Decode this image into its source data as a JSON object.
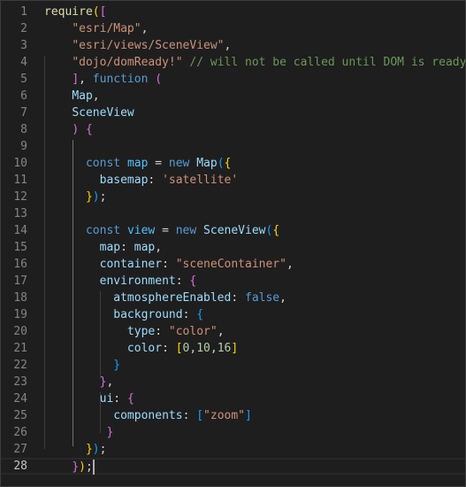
{
  "editor": {
    "language": "javascript",
    "current_line": 28,
    "lines": [
      {
        "n": "1",
        "tokens": [
          [
            "fn",
            "require"
          ],
          [
            "b1",
            "("
          ],
          [
            "b2",
            "["
          ]
        ]
      },
      {
        "n": "2",
        "tokens": [
          [
            "pun",
            "    "
          ],
          [
            "str",
            "\"esri/Map\""
          ],
          [
            "pun",
            ","
          ]
        ]
      },
      {
        "n": "3",
        "tokens": [
          [
            "pun",
            "    "
          ],
          [
            "str",
            "\"esri/views/SceneView\""
          ],
          [
            "pun",
            ","
          ]
        ]
      },
      {
        "n": "4",
        "tokens": [
          [
            "pun",
            "    "
          ],
          [
            "str",
            "\"dojo/domReady!\""
          ],
          [
            "pun",
            " "
          ],
          [
            "cmt",
            "// will not be called until DOM is ready"
          ]
        ]
      },
      {
        "n": "5",
        "tokens": [
          [
            "pun",
            "    "
          ],
          [
            "b2",
            "]"
          ],
          [
            "pun",
            ", "
          ],
          [
            "kw",
            "function"
          ],
          [
            "pun",
            " "
          ],
          [
            "b2",
            "("
          ]
        ]
      },
      {
        "n": "6",
        "tokens": [
          [
            "pun",
            "    "
          ],
          [
            "var",
            "Map"
          ],
          [
            "pun",
            ","
          ]
        ]
      },
      {
        "n": "7",
        "tokens": [
          [
            "pun",
            "    "
          ],
          [
            "var",
            "SceneView"
          ]
        ]
      },
      {
        "n": "8",
        "tokens": [
          [
            "pun",
            "    "
          ],
          [
            "b2",
            ")"
          ],
          [
            "pun",
            " "
          ],
          [
            "b2",
            "{"
          ]
        ]
      },
      {
        "n": "9",
        "tokens": []
      },
      {
        "n": "10",
        "tokens": [
          [
            "pun",
            "      "
          ],
          [
            "kw",
            "const"
          ],
          [
            "pun",
            " "
          ],
          [
            "cvar",
            "map"
          ],
          [
            "pun",
            " = "
          ],
          [
            "kw",
            "new"
          ],
          [
            "pun",
            " "
          ],
          [
            "var",
            "Map"
          ],
          [
            "b3",
            "("
          ],
          [
            "b1",
            "{"
          ]
        ]
      },
      {
        "n": "11",
        "tokens": [
          [
            "pun",
            "        "
          ],
          [
            "var",
            "basemap"
          ],
          [
            "pun",
            ": "
          ],
          [
            "str",
            "'satellite'"
          ]
        ]
      },
      {
        "n": "12",
        "tokens": [
          [
            "pun",
            "      "
          ],
          [
            "b1",
            "}"
          ],
          [
            "b3",
            ")"
          ],
          [
            "pun",
            ";"
          ]
        ]
      },
      {
        "n": "13",
        "tokens": []
      },
      {
        "n": "14",
        "tokens": [
          [
            "pun",
            "      "
          ],
          [
            "kw",
            "const"
          ],
          [
            "pun",
            " "
          ],
          [
            "cvar",
            "view"
          ],
          [
            "pun",
            " = "
          ],
          [
            "kw",
            "new"
          ],
          [
            "pun",
            " "
          ],
          [
            "var",
            "SceneView"
          ],
          [
            "b3",
            "("
          ],
          [
            "b1",
            "{"
          ]
        ]
      },
      {
        "n": "15",
        "tokens": [
          [
            "pun",
            "        "
          ],
          [
            "var",
            "map"
          ],
          [
            "pun",
            ": "
          ],
          [
            "var",
            "map"
          ],
          [
            "pun",
            ","
          ]
        ]
      },
      {
        "n": "16",
        "tokens": [
          [
            "pun",
            "        "
          ],
          [
            "var",
            "container"
          ],
          [
            "pun",
            ": "
          ],
          [
            "str",
            "\"sceneContainer\""
          ],
          [
            "pun",
            ","
          ]
        ]
      },
      {
        "n": "17",
        "tokens": [
          [
            "pun",
            "        "
          ],
          [
            "var",
            "environment"
          ],
          [
            "pun",
            ": "
          ],
          [
            "b2",
            "{"
          ]
        ]
      },
      {
        "n": "18",
        "tokens": [
          [
            "pun",
            "          "
          ],
          [
            "var",
            "atmosphereEnabled"
          ],
          [
            "pun",
            ": "
          ],
          [
            "kw",
            "false"
          ],
          [
            "pun",
            ","
          ]
        ]
      },
      {
        "n": "19",
        "tokens": [
          [
            "pun",
            "          "
          ],
          [
            "var",
            "background"
          ],
          [
            "pun",
            ": "
          ],
          [
            "b3",
            "{"
          ]
        ]
      },
      {
        "n": "20",
        "tokens": [
          [
            "pun",
            "            "
          ],
          [
            "var",
            "type"
          ],
          [
            "pun",
            ": "
          ],
          [
            "str",
            "\"color\""
          ],
          [
            "pun",
            ","
          ]
        ]
      },
      {
        "n": "21",
        "tokens": [
          [
            "pun",
            "            "
          ],
          [
            "var",
            "color"
          ],
          [
            "pun",
            ": "
          ],
          [
            "b1",
            "["
          ],
          [
            "num",
            "0"
          ],
          [
            "pun",
            ","
          ],
          [
            "num",
            "10"
          ],
          [
            "pun",
            ","
          ],
          [
            "num",
            "16"
          ],
          [
            "b1",
            "]"
          ]
        ]
      },
      {
        "n": "22",
        "tokens": [
          [
            "pun",
            "          "
          ],
          [
            "b3",
            "}"
          ]
        ]
      },
      {
        "n": "23",
        "tokens": [
          [
            "pun",
            "        "
          ],
          [
            "b2",
            "}"
          ],
          [
            "pun",
            ","
          ]
        ]
      },
      {
        "n": "24",
        "tokens": [
          [
            "pun",
            "        "
          ],
          [
            "var",
            "ui"
          ],
          [
            "pun",
            ": "
          ],
          [
            "b2",
            "{"
          ]
        ]
      },
      {
        "n": "25",
        "tokens": [
          [
            "pun",
            "          "
          ],
          [
            "var",
            "components"
          ],
          [
            "pun",
            ": "
          ],
          [
            "b3",
            "["
          ],
          [
            "str",
            "\"zoom\""
          ],
          [
            "b3",
            "]"
          ]
        ]
      },
      {
        "n": "26",
        "tokens": [
          [
            "pun",
            "         "
          ],
          [
            "b2",
            "}"
          ]
        ]
      },
      {
        "n": "27",
        "tokens": [
          [
            "pun",
            "      "
          ],
          [
            "b1",
            "}"
          ],
          [
            "b3",
            ")"
          ],
          [
            "pun",
            ";"
          ]
        ]
      },
      {
        "n": "28",
        "tokens": [
          [
            "pun",
            "    "
          ],
          [
            "b2",
            "}"
          ],
          [
            "b1",
            ")"
          ],
          [
            "pun",
            ";"
          ]
        ]
      }
    ]
  }
}
